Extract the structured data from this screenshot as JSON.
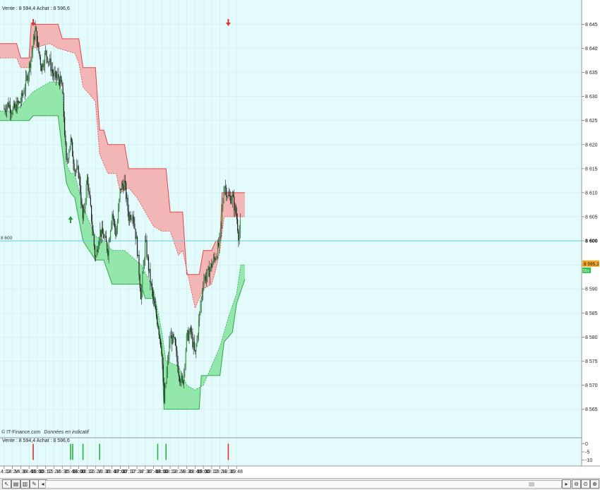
{
  "header": {
    "main_quote": "Vente : 8 594,4 Achat : 8 596,6",
    "sub_quote": "Vente : 8 594,4 Achat : 8 596,6"
  },
  "watermark": {
    "source": "© IT-Finance.com",
    "note": "Données en indicatif"
  },
  "colors": {
    "background": "#e3fbfb",
    "upper_band": "#f3b2b2",
    "upper_line": "#e0484a",
    "lower_band": "#8fe6a5",
    "lower_line": "#2fa84a",
    "candle_up": "#2e9a3a",
    "candle_down": "#1e1e1e",
    "reference_line": "#6cc9e8",
    "price_badge": "#f5a623"
  },
  "chart_data": {
    "type": "candlestick",
    "y_range": [
      8562,
      8648
    ],
    "y_ticks": [
      "8 645",
      "8 640",
      "8 635",
      "8 630",
      "8 625",
      "8 620",
      "8 615",
      "8 610",
      "8 605",
      "8 600",
      "8 595",
      "8 590",
      "8 585",
      "8 580",
      "8 575",
      "8 570",
      "8 565"
    ],
    "x_ticks": [
      "14:12",
      "14:24",
      "14:36",
      "14:48",
      "15:00",
      "15:12",
      "15:24",
      "15:36",
      "15:48",
      "16:00",
      "16:12",
      "16:24",
      "16:36",
      "16:48",
      "17:00",
      "17:12",
      "17:24",
      "17:36",
      "17:48",
      "18:00",
      "18:12",
      "18:24",
      "18:36",
      "18:48",
      "19:00",
      "19:12",
      "19:24",
      "19:36",
      "19:48"
    ],
    "x_ticks_bold": [
      "15:00",
      "16:00",
      "17:00",
      "18:00",
      "19:00"
    ],
    "reference_line": {
      "value": 8600,
      "label": "8 600",
      "right_label": "8 600"
    },
    "last_price": {
      "value": 8595.2,
      "label": "8 595,2"
    },
    "green_marker": {
      "label": "55s"
    },
    "price_path": [
      [
        "14:12",
        8627.5
      ],
      [
        "14:18",
        8628.5
      ],
      [
        "14:24",
        8627
      ],
      [
        "14:30",
        8628
      ],
      [
        "14:36",
        8629
      ],
      [
        "14:42",
        8632
      ],
      [
        "14:48",
        8636
      ],
      [
        "14:54",
        8641
      ],
      [
        "14:57",
        8644
      ],
      [
        "15:00",
        8641
      ],
      [
        "15:06",
        8636
      ],
      [
        "15:12",
        8639
      ],
      [
        "15:18",
        8637
      ],
      [
        "15:24",
        8634
      ],
      [
        "15:30",
        8634
      ],
      [
        "15:36",
        8632
      ],
      [
        "15:42",
        8616
      ],
      [
        "15:48",
        8621
      ],
      [
        "15:54",
        8615
      ],
      [
        "16:00",
        8614
      ],
      [
        "16:06",
        8604
      ],
      [
        "16:12",
        8613
      ],
      [
        "16:18",
        8605
      ],
      [
        "16:24",
        8596
      ],
      [
        "16:30",
        8602
      ],
      [
        "16:36",
        8601
      ],
      [
        "16:42",
        8598
      ],
      [
        "16:48",
        8606
      ],
      [
        "16:54",
        8601
      ],
      [
        "17:00",
        8611
      ],
      [
        "17:06",
        8612
      ],
      [
        "17:12",
        8605
      ],
      [
        "17:18",
        8606
      ],
      [
        "17:24",
        8599
      ],
      [
        "17:30",
        8588
      ],
      [
        "17:36",
        8600
      ],
      [
        "17:42",
        8593
      ],
      [
        "17:48",
        8587
      ],
      [
        "17:54",
        8583
      ],
      [
        "18:00",
        8577
      ],
      [
        "18:03",
        8566
      ],
      [
        "18:06",
        8571
      ],
      [
        "18:12",
        8580
      ],
      [
        "18:18",
        8579
      ],
      [
        "18:24",
        8573
      ],
      [
        "18:30",
        8570
      ],
      [
        "18:36",
        8580
      ],
      [
        "18:42",
        8581
      ],
      [
        "18:48",
        8576
      ],
      [
        "18:54",
        8584
      ],
      [
        "19:00",
        8592
      ],
      [
        "19:06",
        8593
      ],
      [
        "19:12",
        8595
      ],
      [
        "19:18",
        8597
      ],
      [
        "19:24",
        8600
      ],
      [
        "19:30",
        8612
      ],
      [
        "19:36",
        8609
      ],
      [
        "19:42",
        8609
      ],
      [
        "19:48",
        8605
      ],
      [
        "19:51",
        8601
      ],
      [
        "19:54",
        8604
      ]
    ],
    "upper_band_top": [
      [
        "14:00",
        8641
      ],
      [
        "14:30",
        8641
      ],
      [
        "14:36",
        8638
      ],
      [
        "14:48",
        8638
      ],
      [
        "14:51",
        8645
      ],
      [
        "15:30",
        8645
      ],
      [
        "15:36",
        8642
      ],
      [
        "16:00",
        8642
      ],
      [
        "16:06",
        8636
      ],
      [
        "16:24",
        8636
      ],
      [
        "16:30",
        8623
      ],
      [
        "16:36",
        8623
      ],
      [
        "16:42",
        8620
      ],
      [
        "17:06",
        8620
      ],
      [
        "17:12",
        8615
      ],
      [
        "18:06",
        8615
      ],
      [
        "18:12",
        8606
      ],
      [
        "18:30",
        8606
      ],
      [
        "18:36",
        8593
      ],
      [
        "18:54",
        8593
      ],
      [
        "19:00",
        8598
      ],
      [
        "19:12",
        8598
      ],
      [
        "19:18",
        8600
      ],
      [
        "19:24",
        8600
      ],
      [
        "19:27",
        8610
      ],
      [
        "20:00",
        8610
      ]
    ],
    "upper_band_bottom": [
      [
        "14:00",
        8638
      ],
      [
        "14:30",
        8638
      ],
      [
        "14:36",
        8636
      ],
      [
        "14:48",
        8636
      ],
      [
        "14:54",
        8640
      ],
      [
        "15:18",
        8641
      ],
      [
        "15:30",
        8640
      ],
      [
        "15:54",
        8639
      ],
      [
        "16:00",
        8637
      ],
      [
        "16:06",
        8632
      ],
      [
        "16:24",
        8629
      ],
      [
        "16:30",
        8618
      ],
      [
        "16:42",
        8614
      ],
      [
        "16:54",
        8614
      ],
      [
        "17:00",
        8610
      ],
      [
        "17:12",
        8611
      ],
      [
        "17:24",
        8609
      ],
      [
        "17:36",
        8606
      ],
      [
        "17:48",
        8603
      ],
      [
        "18:00",
        8602
      ],
      [
        "18:12",
        8602
      ],
      [
        "18:24",
        8597
      ],
      [
        "18:30",
        8598
      ],
      [
        "18:48",
        8586
      ],
      [
        "18:54",
        8588
      ],
      [
        "19:00",
        8590
      ],
      [
        "19:12",
        8591
      ],
      [
        "19:18",
        8594
      ],
      [
        "19:24",
        8598
      ],
      [
        "19:30",
        8605
      ],
      [
        "20:00",
        8605
      ]
    ],
    "lower_band_top": [
      [
        "14:00",
        8627
      ],
      [
        "14:24",
        8627
      ],
      [
        "14:36",
        8628
      ],
      [
        "14:54",
        8631
      ],
      [
        "15:18",
        8633
      ],
      [
        "15:30",
        8633
      ],
      [
        "15:36",
        8631
      ],
      [
        "15:42",
        8616
      ],
      [
        "15:48",
        8614
      ],
      [
        "15:54",
        8614
      ],
      [
        "16:06",
        8607
      ],
      [
        "16:24",
        8601
      ],
      [
        "16:36",
        8600
      ],
      [
        "16:48",
        8598
      ],
      [
        "17:06",
        8598
      ],
      [
        "17:30",
        8595
      ],
      [
        "17:48",
        8590
      ],
      [
        "18:00",
        8581
      ],
      [
        "18:06",
        8575
      ],
      [
        "18:24",
        8574
      ],
      [
        "18:36",
        8570
      ],
      [
        "18:48",
        8569
      ],
      [
        "19:00",
        8570
      ],
      [
        "19:12",
        8574
      ],
      [
        "19:24",
        8578
      ],
      [
        "19:36",
        8584
      ],
      [
        "19:48",
        8589
      ],
      [
        "19:54",
        8595
      ],
      [
        "20:00",
        8595
      ]
    ],
    "lower_band_bottom": [
      [
        "14:00",
        8625
      ],
      [
        "14:48",
        8625
      ],
      [
        "14:54",
        8626
      ],
      [
        "15:30",
        8626
      ],
      [
        "15:36",
        8619
      ],
      [
        "15:42",
        8612
      ],
      [
        "15:48",
        8610
      ],
      [
        "15:54",
        8609
      ],
      [
        "16:06",
        8600
      ],
      [
        "16:24",
        8596
      ],
      [
        "16:36",
        8596
      ],
      [
        "16:48",
        8591
      ],
      [
        "17:30",
        8591
      ],
      [
        "17:36",
        8588
      ],
      [
        "17:48",
        8588
      ],
      [
        "18:00",
        8578
      ],
      [
        "18:03",
        8565
      ],
      [
        "18:54",
        8565
      ],
      [
        "18:57",
        8572
      ],
      [
        "19:24",
        8572
      ],
      [
        "19:30",
        8579
      ],
      [
        "19:42",
        8581
      ],
      [
        "19:48",
        8587
      ],
      [
        "20:00",
        8592
      ]
    ],
    "signals": [
      {
        "time": "14:54",
        "direction": "sell"
      },
      {
        "time": "15:48",
        "direction": "buy"
      },
      {
        "time": "19:36",
        "direction": "sell"
      }
    ],
    "sub_panel": {
      "y_ticks": [
        "0",
        "-5",
        "-10"
      ],
      "y_range": [
        -12,
        2
      ],
      "bars": [
        {
          "time": "14:54",
          "value": -10,
          "color": "red"
        },
        {
          "time": "15:48",
          "value": -10,
          "color": "green"
        },
        {
          "time": "15:51",
          "value": -10,
          "color": "green"
        },
        {
          "time": "16:06",
          "value": -10,
          "color": "green"
        },
        {
          "time": "16:30",
          "value": -10,
          "color": "green"
        },
        {
          "time": "17:54",
          "value": -10,
          "color": "green"
        },
        {
          "time": "18:06",
          "value": -10,
          "color": "green"
        },
        {
          "time": "19:36",
          "value": -10,
          "color": "red"
        }
      ]
    }
  },
  "toolbar": {
    "icons": [
      "cursor-icon",
      "chart-type-icon",
      "bars-icon",
      "draw-icon",
      "grid-icon",
      "save-icon"
    ],
    "zoom": [
      "zoom-out-icon",
      "zoom-reset-icon",
      "zoom-minus-icon",
      "zoom-plus-icon"
    ]
  }
}
